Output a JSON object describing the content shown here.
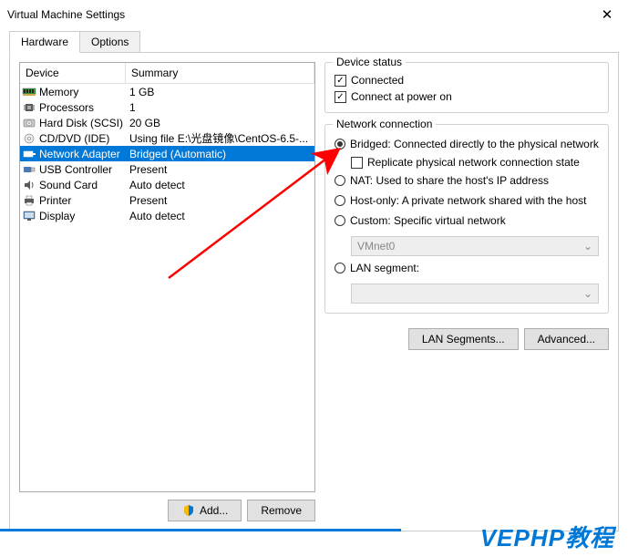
{
  "window": {
    "title": "Virtual Machine Settings"
  },
  "tabs": {
    "hardware": "Hardware",
    "options": "Options"
  },
  "headers": {
    "device": "Device",
    "summary": "Summary"
  },
  "devices": [
    {
      "name": "Memory",
      "summary": "1 GB",
      "icon": "memory"
    },
    {
      "name": "Processors",
      "summary": "1",
      "icon": "cpu"
    },
    {
      "name": "Hard Disk (SCSI)",
      "summary": "20 GB",
      "icon": "hdd"
    },
    {
      "name": "CD/DVD (IDE)",
      "summary": "Using file E:\\光盘镜像\\CentOS-6.5-...",
      "icon": "cd"
    },
    {
      "name": "Network Adapter",
      "summary": "Bridged (Automatic)",
      "icon": "network",
      "selected": true
    },
    {
      "name": "USB Controller",
      "summary": "Present",
      "icon": "usb"
    },
    {
      "name": "Sound Card",
      "summary": "Auto detect",
      "icon": "sound"
    },
    {
      "name": "Printer",
      "summary": "Present",
      "icon": "printer"
    },
    {
      "name": "Display",
      "summary": "Auto detect",
      "icon": "display"
    }
  ],
  "buttons": {
    "add": "Add...",
    "remove": "Remove",
    "lan_segments": "LAN Segments...",
    "advanced": "Advanced..."
  },
  "device_status": {
    "title": "Device status",
    "connected": "Connected",
    "connect_power": "Connect at power on"
  },
  "network": {
    "title": "Network connection",
    "bridged": "Bridged: Connected directly to the physical network",
    "replicate": "Replicate physical network connection state",
    "nat": "NAT: Used to share the host's IP address",
    "hostonly": "Host-only: A private network shared with the host",
    "custom": "Custom: Specific virtual network",
    "vmnet": "VMnet0",
    "lan": "LAN segment:"
  },
  "brand": "VEPHP教程"
}
